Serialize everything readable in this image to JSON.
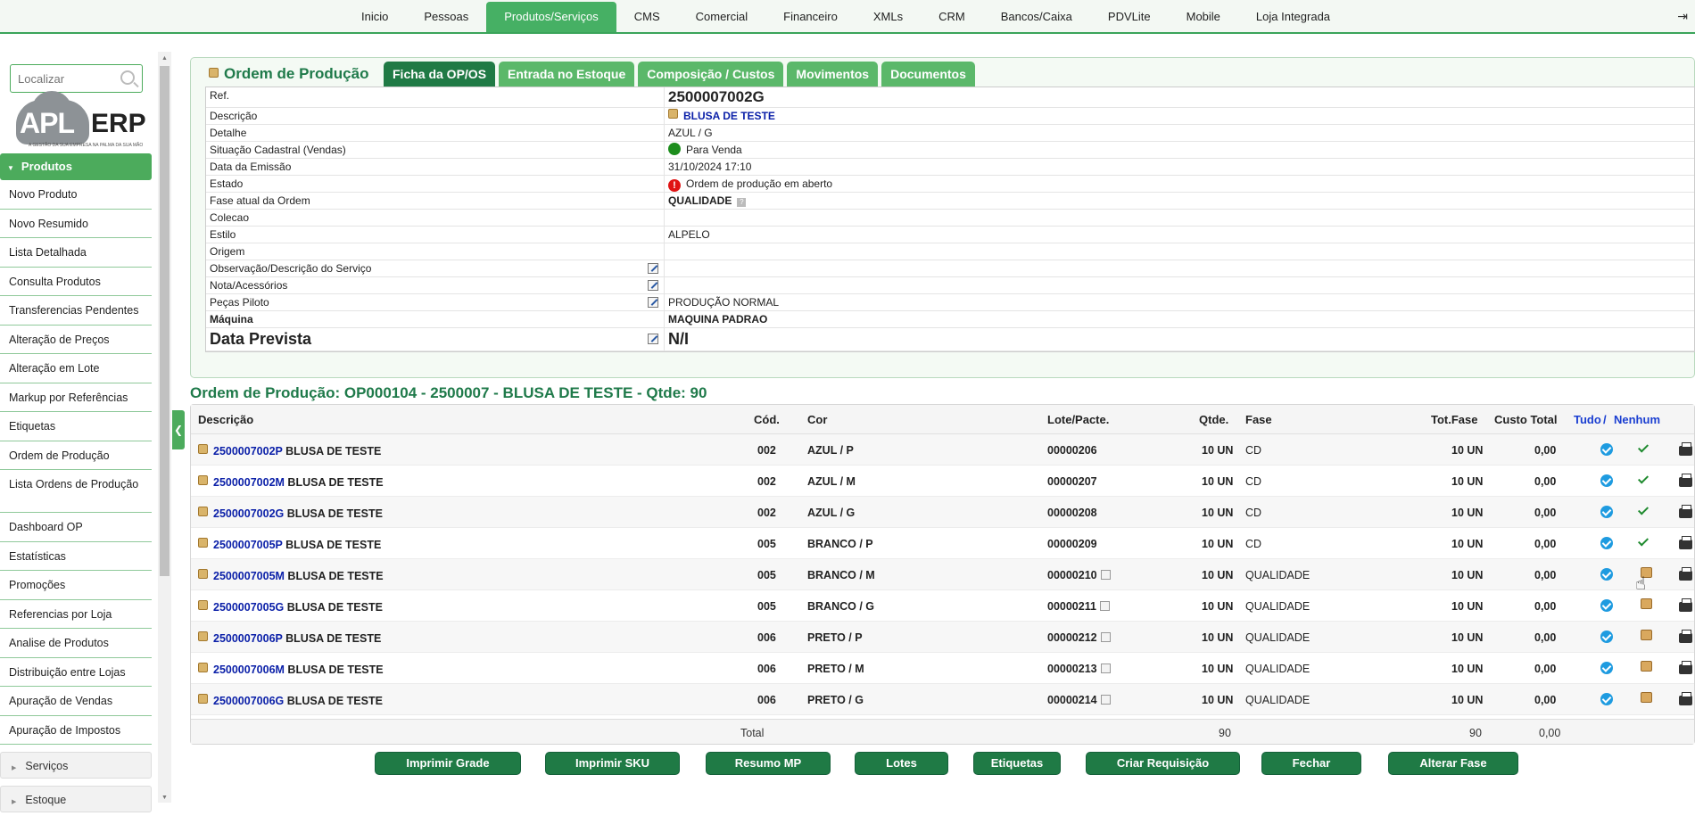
{
  "topnav": {
    "items": [
      "Inicio",
      "Pessoas",
      "Produtos/Serviços",
      "CMS",
      "Comercial",
      "Financeiro",
      "XMLs",
      "CRM",
      "Bancos/Caixa",
      "PDVLite",
      "Mobile",
      "Loja Integrada"
    ],
    "active_index": 2
  },
  "sidebar": {
    "search_placeholder": "Localizar",
    "logo": {
      "apl": "APL",
      "erp": "ERP",
      "tagline": "A GESTÃO DA SUA EMPRESA NA PALMA DA SUA MÃO"
    },
    "section": "Produtos",
    "items": [
      "Novo Produto",
      "Novo Resumido",
      "Lista Detalhada",
      "Consulta Produtos",
      "Transferencias Pendentes",
      "Alteração de Preços",
      "Alteração em Lote",
      "Markup por Referências",
      "Etiquetas",
      "Ordem de Produção",
      "Lista Ordens de Produção",
      "Dashboard OP",
      "Estatísticas",
      "Promoções",
      "Referencias por Loja",
      "Analise de Produtos",
      "Distribuição entre Lojas",
      "Apuração de Vendas",
      "Apuração de Impostos"
    ],
    "subsections": [
      "Serviços",
      "Estoque"
    ]
  },
  "panel": {
    "title": "Ordem de Produção",
    "tabs": [
      "Ficha da OP/OS",
      "Entrada no Estoque",
      "Composição / Custos",
      "Movimentos",
      "Documentos"
    ],
    "active_tab": 0,
    "fields": {
      "ref_label": "Ref.",
      "ref_value": "2500007002G",
      "descricao_label": "Descrição",
      "descricao_value": "BLUSA DE TESTE",
      "detalhe_label": "Detalhe",
      "detalhe_value": "AZUL / G",
      "situacao_label": "Situação Cadastral (Vendas)",
      "situacao_value": "Para Venda",
      "emissao_label": "Data da Emissão",
      "emissao_value": "31/10/2024 17:10",
      "estado_label": "Estado",
      "estado_value": "Ordem de produção em aberto",
      "fase_label": "Fase atual da Ordem",
      "fase_value": "QUALIDADE",
      "colecao_label": "Colecao",
      "colecao_value": "",
      "estilo_label": "Estilo",
      "estilo_value": "ALPELO",
      "origem_label": "Origem",
      "origem_value": "",
      "obs_label": "Observação/Descrição do Serviço",
      "obs_value": "",
      "nota_label": "Nota/Acessórios",
      "nota_value": "",
      "pecas_label": "Peças Piloto",
      "pecas_value": "PRODUÇÃO NORMAL",
      "maquina_label": "Máquina",
      "maquina_value": "MAQUINA PADRAO",
      "prevista_label": "Data Prevista",
      "prevista_value": "N/I"
    }
  },
  "op_title": "Ordem de Produção: OP000104 - 2500007 - BLUSA DE TESTE - Qtde: 90",
  "grid": {
    "headers": {
      "descricao": "Descrição",
      "cod": "Cód.",
      "cor": "Cor",
      "lote": "Lote/Pacte.",
      "qtde": "Qtde.",
      "fase": "Fase",
      "totfase": "Tot.Fase",
      "custo": "Custo Total",
      "tudo": "Tudo",
      "sep": "/",
      "nenhum": "Nenhum"
    },
    "rows": [
      {
        "ref": "2500007002P",
        "desc": "BLUSA DE TESTE",
        "cod": "002",
        "cor": "AZUL / P",
        "lote": "00000206",
        "qtde": "10 UN",
        "fase": "CD",
        "totfase": "10 UN",
        "custo": "0,00",
        "status": "done"
      },
      {
        "ref": "2500007002M",
        "desc": "BLUSA DE TESTE",
        "cod": "002",
        "cor": "AZUL / M",
        "lote": "00000207",
        "qtde": "10 UN",
        "fase": "CD",
        "totfase": "10 UN",
        "custo": "0,00",
        "status": "done"
      },
      {
        "ref": "2500007002G",
        "desc": "BLUSA DE TESTE",
        "cod": "002",
        "cor": "AZUL / G",
        "lote": "00000208",
        "qtde": "10 UN",
        "fase": "CD",
        "totfase": "10 UN",
        "custo": "0,00",
        "status": "done"
      },
      {
        "ref": "2500007005P",
        "desc": "BLUSA DE TESTE",
        "cod": "005",
        "cor": "BRANCO / P",
        "lote": "00000209",
        "qtde": "10 UN",
        "fase": "CD",
        "totfase": "10 UN",
        "custo": "0,00",
        "status": "done"
      },
      {
        "ref": "2500007005M",
        "desc": "BLUSA DE TESTE",
        "cod": "005",
        "cor": "BRANCO / M",
        "lote": "00000210",
        "qtde": "10 UN",
        "fase": "QUALIDADE",
        "totfase": "10 UN",
        "custo": "0,00",
        "status": "pending"
      },
      {
        "ref": "2500007005G",
        "desc": "BLUSA DE TESTE",
        "cod": "005",
        "cor": "BRANCO / G",
        "lote": "00000211",
        "qtde": "10 UN",
        "fase": "QUALIDADE",
        "totfase": "10 UN",
        "custo": "0,00",
        "status": "pending"
      },
      {
        "ref": "2500007006P",
        "desc": "BLUSA DE TESTE",
        "cod": "006",
        "cor": "PRETO / P",
        "lote": "00000212",
        "qtde": "10 UN",
        "fase": "QUALIDADE",
        "totfase": "10 UN",
        "custo": "0,00",
        "status": "pending"
      },
      {
        "ref": "2500007006M",
        "desc": "BLUSA DE TESTE",
        "cod": "006",
        "cor": "PRETO / M",
        "lote": "00000213",
        "qtde": "10 UN",
        "fase": "QUALIDADE",
        "totfase": "10 UN",
        "custo": "0,00",
        "status": "pending"
      },
      {
        "ref": "2500007006G",
        "desc": "BLUSA DE TESTE",
        "cod": "006",
        "cor": "PRETO / G",
        "lote": "00000214",
        "qtde": "10 UN",
        "fase": "QUALIDADE",
        "totfase": "10 UN",
        "custo": "0,00",
        "status": "pending"
      }
    ],
    "footer": {
      "label": "Total",
      "qtde": "90",
      "totfase": "90",
      "custo": "0,00"
    }
  },
  "buttons": [
    "Imprimir Grade",
    "Imprimir SKU",
    "Resumo MP",
    "Lotes",
    "Etiquetas",
    "Criar Requisição",
    "Fechar",
    "Alterar Fase"
  ],
  "colors": {
    "brand_green": "#4cab5c",
    "dark_green": "#1f7a45",
    "title_green": "#1f7a4a",
    "link_blue": "#0a1fa8"
  },
  "icons": {
    "exit": "exit-icon",
    "search": "search-icon",
    "check": "check-circle-icon",
    "done": "checkmark-icon",
    "pending": "package-icon",
    "print": "printer-icon",
    "edit": "edit-icon"
  }
}
